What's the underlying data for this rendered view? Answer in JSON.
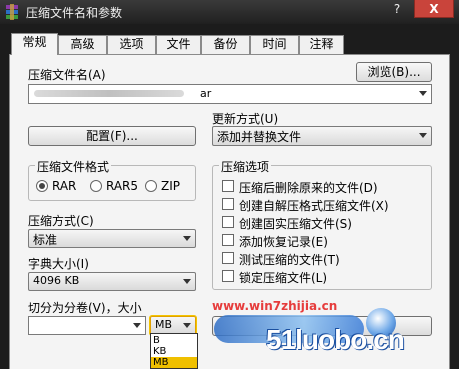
{
  "window": {
    "title": "压缩文件名和参数",
    "help_label": "?",
    "close_label": "X"
  },
  "tabs": [
    {
      "label": "常规"
    },
    {
      "label": "高级"
    },
    {
      "label": "选项"
    },
    {
      "label": "文件"
    },
    {
      "label": "备份"
    },
    {
      "label": "时间"
    },
    {
      "label": "注释"
    }
  ],
  "archive_name": {
    "label": "压缩文件名(A)",
    "browse_label": "浏览(B)...",
    "value_suffix": "ar"
  },
  "profiles_button": "配置(F)...",
  "update_mode": {
    "label": "更新方式(U)",
    "value": "添加并替换文件"
  },
  "archive_format": {
    "legend": "压缩文件格式",
    "options": [
      {
        "label": "RAR",
        "selected": true
      },
      {
        "label": "RAR5",
        "selected": false
      },
      {
        "label": "ZIP",
        "selected": false
      }
    ]
  },
  "compression_method": {
    "label": "压缩方式(C)",
    "value": "标准"
  },
  "dictionary_size": {
    "label": "字典大小(I)",
    "value": "4096 KB"
  },
  "split_volumes": {
    "label": "切分为分卷(V)，大小",
    "value": "",
    "unit": "MB",
    "unit_options": [
      "B",
      "KB",
      "MB"
    ]
  },
  "archiving_options": {
    "legend": "压缩选项",
    "items": [
      {
        "label": "压缩后删除原来的文件(D)",
        "checked": false
      },
      {
        "label": "创建自解压格式压缩文件(X)",
        "checked": false
      },
      {
        "label": "创建固实压缩文件(S)",
        "checked": false
      },
      {
        "label": "添加恢复记录(E)",
        "checked": false
      },
      {
        "label": "测试压缩的文件(T)",
        "checked": false
      },
      {
        "label": "锁定压缩文件(L)",
        "checked": false
      }
    ]
  },
  "watermark": {
    "url": "www.win7zhijia.cn",
    "brand": "51luobo.cn"
  }
}
